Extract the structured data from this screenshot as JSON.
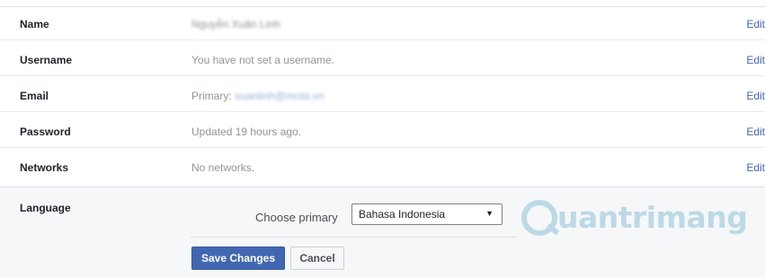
{
  "settings": {
    "rows": [
      {
        "label": "Name",
        "value": "Nguyễn Xuân Linh",
        "edit": "Edit"
      },
      {
        "label": "Username",
        "value": "You have not set a username.",
        "edit": "Edit"
      },
      {
        "label": "Email",
        "value_prefix": "Primary:",
        "value": "xuanlinh@mota.vn",
        "edit": "Edit"
      },
      {
        "label": "Password",
        "value": "Updated 19 hours ago.",
        "edit": "Edit"
      },
      {
        "label": "Networks",
        "value": "No networks.",
        "edit": "Edit"
      }
    ],
    "language": {
      "label": "Language",
      "choose_label": "Choose primary",
      "selected": "Bahasa Indonesia",
      "save_label": "Save Changes",
      "cancel_label": "Cancel"
    }
  },
  "watermark": {
    "text": "uantrimang",
    "logo_letter": "Q"
  },
  "colors": {
    "link": "#4267b2",
    "muted": "#90949c",
    "panel": "#f6f7f9",
    "watermark": "#bcd9e7"
  }
}
